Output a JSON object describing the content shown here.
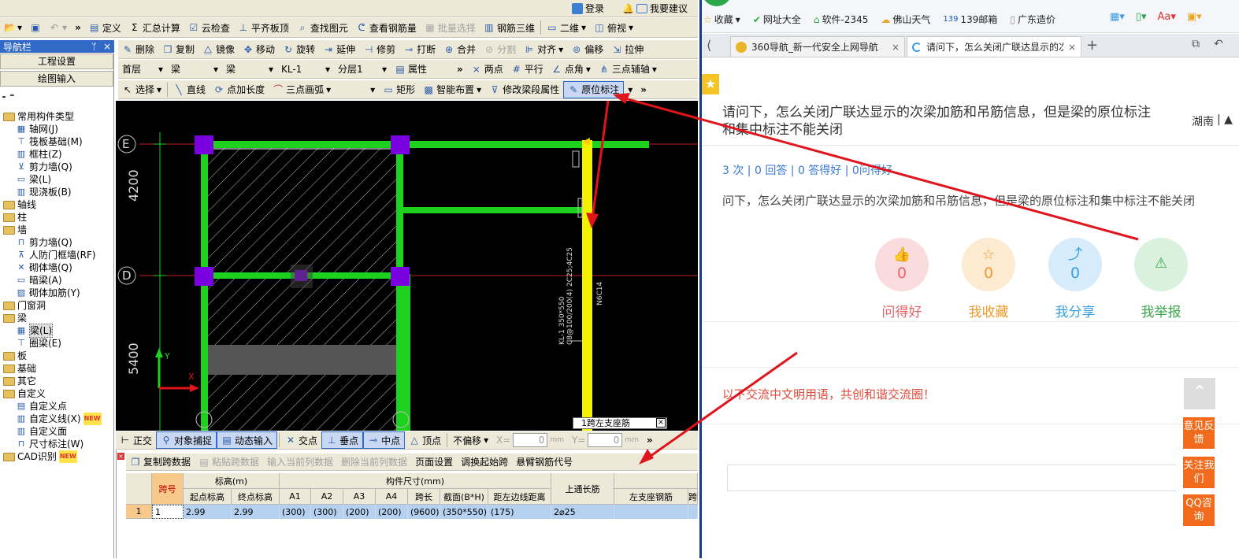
{
  "app": {
    "login": "登录",
    "suggest": "我要建议",
    "nav_title": "导航栏",
    "nav_pin": "ㅁ",
    "nav_close": "×"
  },
  "toolbar1": {
    "items": [
      "定义",
      "汇总计算",
      "云检查",
      "平齐板顶",
      "查找图元",
      "查看钢筋量",
      "批量选择",
      "钢筋三维"
    ],
    "view_mode": "二维",
    "view_angle": "俯视"
  },
  "toolbar2": {
    "items": [
      "删除",
      "复制",
      "镜像",
      "移动",
      "旋转",
      "延伸",
      "修剪",
      "打断",
      "合并",
      "分割",
      "对齐",
      "偏移",
      "拉伸"
    ]
  },
  "toolbar3": {
    "floor": "首层",
    "type1": "梁",
    "type2": "梁",
    "name": "KL-1",
    "layer": "分层1",
    "property": "属性",
    "tools": [
      "两点",
      "平行",
      "点角",
      "三点辅轴"
    ]
  },
  "toolbar4": {
    "items": [
      "选择",
      "直线",
      "点加长度",
      "三点画弧",
      "矩形",
      "智能布置",
      "修改梁段属性",
      "原位标注"
    ]
  },
  "sidebar": {
    "section1": "工程设置",
    "section2": "绘图输入",
    "tree": [
      {
        "label": "常用构件类型",
        "type": "folder",
        "indent": 0
      },
      {
        "label": "轴网(J)",
        "type": "leaf",
        "indent": 1
      },
      {
        "label": "筏板基础(M)",
        "type": "leaf",
        "indent": 1
      },
      {
        "label": "框柱(Z)",
        "type": "leaf",
        "indent": 1
      },
      {
        "label": "剪力墙(Q)",
        "type": "leaf",
        "indent": 1
      },
      {
        "label": "梁(L)",
        "type": "leaf",
        "indent": 1
      },
      {
        "label": "现浇板(B)",
        "type": "leaf",
        "indent": 1
      },
      {
        "label": "轴线",
        "type": "folder",
        "indent": 0
      },
      {
        "label": "柱",
        "type": "folder",
        "indent": 0
      },
      {
        "label": "墙",
        "type": "folder",
        "indent": 0
      },
      {
        "label": "剪力墙(Q)",
        "type": "leaf",
        "indent": 1
      },
      {
        "label": "人防门框墙(RF)",
        "type": "leaf",
        "indent": 1
      },
      {
        "label": "砌体墙(Q)",
        "type": "leaf",
        "indent": 1
      },
      {
        "label": "暗梁(A)",
        "type": "leaf",
        "indent": 1
      },
      {
        "label": "砌体加筋(Y)",
        "type": "leaf",
        "indent": 1
      },
      {
        "label": "门窗洞",
        "type": "folder",
        "indent": 0
      },
      {
        "label": "梁",
        "type": "folder",
        "indent": 0
      },
      {
        "label": "梁(L)",
        "type": "leaf",
        "indent": 1
      },
      {
        "label": "圈梁(E)",
        "type": "leaf",
        "indent": 1
      },
      {
        "label": "板",
        "type": "folder",
        "indent": 0
      },
      {
        "label": "基础",
        "type": "folder",
        "indent": 0
      },
      {
        "label": "其它",
        "type": "folder",
        "indent": 0
      },
      {
        "label": "自定义",
        "type": "folder",
        "indent": 0
      },
      {
        "label": "自定义点",
        "type": "leaf",
        "indent": 1
      },
      {
        "label": "自定义线(X)",
        "type": "leaf",
        "indent": 1
      },
      {
        "label": "自定义面",
        "type": "leaf",
        "indent": 1
      },
      {
        "label": "尺寸标注(W)",
        "type": "leaf",
        "indent": 1
      },
      {
        "label": "CAD识别",
        "type": "folder",
        "indent": 0
      }
    ],
    "new_badge": "NEW"
  },
  "canvas": {
    "axis_e": "E",
    "axis_d": "D",
    "dim1": "4200",
    "dim2": "5400",
    "ucs_y": "Y",
    "ucs_x": "X",
    "beam_label1": "KL-1 350*550",
    "beam_label2": "C8@100/200(4) 2C25;4C25",
    "beam_label3": "N6C14",
    "popup": "1跨左支座筋"
  },
  "statusbar": {
    "items": [
      "正交",
      "对象捕捉",
      "动态输入",
      "交点",
      "垂点",
      "中点",
      "顶点"
    ],
    "offset": "不偏移",
    "x_label": "X=",
    "x_val": "0",
    "y_label": "Y=",
    "y_val": "0",
    "unit": "mm"
  },
  "table_toolbar": {
    "items": [
      "复制跨数据",
      "粘贴跨数据",
      "输入当前列数据",
      "删除当前列数据",
      "页面设置",
      "调换起始跨",
      "悬臂钢筋代号"
    ]
  },
  "table": {
    "group_headers": {
      "elev": "标高(m)",
      "size": "构件尺寸(mm)"
    },
    "headers": [
      "跨号",
      "起点标高",
      "终点标高",
      "A1",
      "A2",
      "A3",
      "A4",
      "跨长",
      "截面(B*H)",
      "距左边线距离",
      "上通长筋",
      "左支座钢筋",
      "跨"
    ],
    "rows": [
      {
        "idx": "1",
        "cells": [
          "1",
          "2.99",
          "2.99",
          "(300)",
          "(300)",
          "(200)",
          "(200)",
          "(9600)",
          "(350*550)",
          "(175)",
          "2⌀25",
          "",
          ""
        ]
      }
    ]
  },
  "browser": {
    "bookmarks": [
      "收藏",
      "网址大全",
      "软件-2345",
      "佛山天气",
      "139邮箱",
      "广东造价"
    ],
    "tabs": [
      "360导航_新一代安全上网导航",
      "请问下，怎么关闭广联达显示的次"
    ],
    "question_title": "请问下，怎么关闭广联达显示的次梁加筋和吊筋信息，但是梁的原位标注和集中标注不能关闭",
    "location": "湖南",
    "stats": "3 次 | 0 回答 | 0 答得好 | 0问得好",
    "body": "问下，怎么关闭广联达显示的次梁加筋和吊筋信息，但是梁的原位标注和集中标注不能关闭",
    "actions": [
      {
        "label": "问得好",
        "count": "0",
        "color": "#e8636a",
        "bg": "#fbdcde"
      },
      {
        "label": "我收藏",
        "count": "0",
        "color": "#ee9a2c",
        "bg": "#fcebd0"
      },
      {
        "label": "我分享",
        "count": "0",
        "color": "#3a9ee0",
        "bg": "#d6ecfa"
      },
      {
        "label": "我举报",
        "count": "",
        "color": "#3aa64c",
        "bg": "#d9f1dd"
      }
    ],
    "notice": "以下交流中文明用语，共创和谐交流圈！",
    "side_buttons": [
      "意见反馈",
      "关注我们",
      "QQ咨询"
    ]
  },
  "colors": {
    "beam": "#1fd11f",
    "column": "#7b00e0",
    "selected_beam": "#f2f200",
    "annotation_arrow": "#e0141c"
  }
}
